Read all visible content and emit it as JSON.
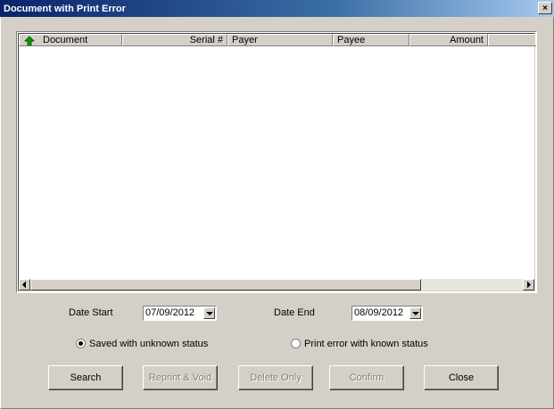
{
  "window": {
    "title": "Document with Print Error",
    "close_glyph": "×"
  },
  "table": {
    "columns": [
      {
        "label": "Document"
      },
      {
        "label": "Serial #"
      },
      {
        "label": "Payer"
      },
      {
        "label": "Payee"
      },
      {
        "label": "Amount"
      }
    ],
    "rows": []
  },
  "filters": {
    "date_start_label": "Date Start",
    "date_start_value": "07/09/2012",
    "date_end_label": "Date End",
    "date_end_value": "08/09/2012",
    "radio_saved_label": "Saved with unknown status",
    "radio_saved_checked": true,
    "radio_print_error_label": "Print error with known status",
    "radio_print_error_checked": false
  },
  "buttons": {
    "search": "Search",
    "reprint_void": "Reprint & Void",
    "delete_only": "Delete Only",
    "confirm": "Confirm",
    "close": "Close"
  },
  "icons": {
    "sort": "up-arrow-icon",
    "scroll_left": "left-arrow-icon",
    "scroll_right": "right-arrow-icon",
    "dropdown": "chevron-down-icon"
  },
  "colors": {
    "title_bar": "#0a246a",
    "sort_arrow": "#008000",
    "window_bg": "#d4d0c8"
  }
}
